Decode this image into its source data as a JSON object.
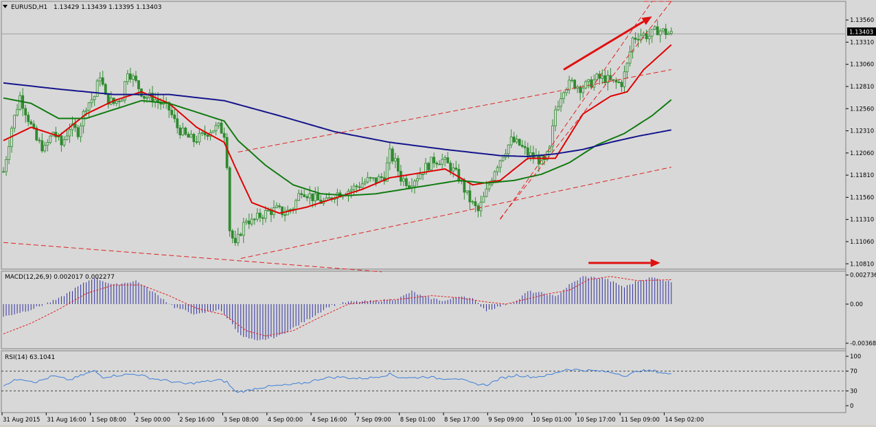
{
  "header": {
    "symbol": "EURUSD,H1",
    "ohlc": "1.13429 1.13439 1.13395 1.13403",
    "menu_icon": "triangle-down-icon"
  },
  "current_price_label": "1.13403",
  "macd_label": "MACD(12,26,9) 0.002017 0.002277",
  "rsi_label": "RSI(14) 63.1041",
  "colors": {
    "background": "#d8d8d8",
    "candle": "#2e8b2e",
    "ma_fast": "#e00000",
    "ma_mid": "#107a10",
    "ma_slow": "#14148c",
    "trendline": "#e02020",
    "annotation_arrow": "#e01010",
    "macd_hist": "#3030a0",
    "macd_signal": "#e02020",
    "rsi_line": "#3c7fd8"
  },
  "chart_data": [
    {
      "type": "candlestick",
      "title": "EURUSD,H1",
      "y_tick_labels": [
        "1.13560",
        "1.13310",
        "1.13060",
        "1.12810",
        "1.12560",
        "1.12310",
        "1.12060",
        "1.11810",
        "1.11560",
        "1.11310",
        "1.11060",
        "1.10810"
      ],
      "ylim": [
        1.1075,
        1.1377
      ],
      "x_tick_labels": [
        "31 Aug 2015",
        "31 Aug 16:00",
        "1 Sep 08:00",
        "2 Sep 00:00",
        "2 Sep 16:00",
        "3 Sep 08:00",
        "4 Sep 00:00",
        "4 Sep 16:00",
        "7 Sep 09:00",
        "8 Sep 01:00",
        "8 Sep 17:00",
        "9 Sep 09:00",
        "10 Sep 01:00",
        "10 Sep 17:00",
        "11 Sep 09:00",
        "14 Sep 02:00"
      ],
      "current_price": 1.13403,
      "close_path": [
        [
          0,
          1.1185
        ],
        [
          3,
          1.1235
        ],
        [
          6,
          1.127
        ],
        [
          9,
          1.1245
        ],
        [
          12,
          1.122
        ],
        [
          15,
          1.121
        ],
        [
          18,
          1.123
        ],
        [
          21,
          1.1215
        ],
        [
          24,
          1.1235
        ],
        [
          27,
          1.123
        ],
        [
          30,
          1.126
        ],
        [
          33,
          1.127
        ],
        [
          35,
          1.1295
        ],
        [
          37,
          1.1268
        ],
        [
          40,
          1.1262
        ],
        [
          43,
          1.127
        ],
        [
          45,
          1.13
        ],
        [
          48,
          1.1285
        ],
        [
          51,
          1.127
        ],
        [
          54,
          1.1268
        ],
        [
          57,
          1.1262
        ],
        [
          60,
          1.1255
        ],
        [
          63,
          1.1235
        ],
        [
          66,
          1.1225
        ],
        [
          69,
          1.122
        ],
        [
          72,
          1.1225
        ],
        [
          75,
          1.1232
        ],
        [
          78,
          1.1235
        ],
        [
          80,
          1.1228
        ],
        [
          81,
          1.1195
        ],
        [
          82,
          1.112
        ],
        [
          84,
          1.11
        ],
        [
          86,
          1.1118
        ],
        [
          88,
          1.1132
        ],
        [
          90,
          1.1128
        ],
        [
          93,
          1.1135
        ],
        [
          96,
          1.114
        ],
        [
          99,
          1.1142
        ],
        [
          102,
          1.1138
        ],
        [
          105,
          1.1145
        ],
        [
          108,
          1.1165
        ],
        [
          111,
          1.1158
        ],
        [
          114,
          1.1152
        ],
        [
          117,
          1.115
        ],
        [
          120,
          1.116
        ],
        [
          123,
          1.1162
        ],
        [
          126,
          1.1165
        ],
        [
          129,
          1.117
        ],
        [
          132,
          1.1175
        ],
        [
          135,
          1.1175
        ],
        [
          138,
          1.118
        ],
        [
          140,
          1.1205
        ],
        [
          142,
          1.1195
        ],
        [
          144,
          1.1178
        ],
        [
          147,
          1.1172
        ],
        [
          150,
          1.118
        ],
        [
          153,
          1.119
        ],
        [
          156,
          1.1198
        ],
        [
          159,
          1.1198
        ],
        [
          162,
          1.119
        ],
        [
          165,
          1.1178
        ],
        [
          168,
          1.1158
        ],
        [
          170,
          1.1148
        ],
        [
          172,
          1.114
        ],
        [
          175,
          1.1162
        ],
        [
          178,
          1.1188
        ],
        [
          181,
          1.1205
        ],
        [
          184,
          1.122
        ],
        [
          187,
          1.1215
        ],
        [
          190,
          1.1205
        ],
        [
          193,
          1.12
        ],
        [
          196,
          1.1195
        ],
        [
          198,
          1.121
        ],
        [
          200,
          1.1255
        ],
        [
          203,
          1.128
        ],
        [
          206,
          1.1285
        ],
        [
          209,
          1.128
        ],
        [
          212,
          1.1283
        ],
        [
          215,
          1.129
        ],
        [
          218,
          1.129
        ],
        [
          221,
          1.1285
        ],
        [
          224,
          1.1285
        ],
        [
          226,
          1.1305
        ],
        [
          228,
          1.1335
        ],
        [
          231,
          1.134
        ],
        [
          234,
          1.1338
        ],
        [
          237,
          1.1345
        ],
        [
          240,
          1.1342
        ],
        [
          242,
          1.134
        ]
      ],
      "series": [
        {
          "name": "",
          "kind": "ma_fast",
          "period": "",
          "points": [
            [
              0,
              1.122
            ],
            [
              10,
              1.1235
            ],
            [
              20,
              1.1225
            ],
            [
              30,
              1.125
            ],
            [
              40,
              1.1265
            ],
            [
              50,
              1.1275
            ],
            [
              60,
              1.1262
            ],
            [
              70,
              1.1235
            ],
            [
              80,
              1.1218
            ],
            [
              84,
              1.119
            ],
            [
              90,
              1.115
            ],
            [
              100,
              1.1138
            ],
            [
              110,
              1.1145
            ],
            [
              120,
              1.1155
            ],
            [
              130,
              1.1165
            ],
            [
              140,
              1.1178
            ],
            [
              150,
              1.1183
            ],
            [
              160,
              1.1188
            ],
            [
              170,
              1.117
            ],
            [
              180,
              1.1175
            ],
            [
              190,
              1.12
            ],
            [
              200,
              1.12
            ],
            [
              210,
              1.125
            ],
            [
              220,
              1.127
            ],
            [
              226,
              1.1275
            ],
            [
              232,
              1.13
            ],
            [
              242,
              1.1328
            ]
          ]
        },
        {
          "name": "",
          "kind": "ma_mid",
          "points": [
            [
              0,
              1.1268
            ],
            [
              10,
              1.1262
            ],
            [
              20,
              1.1245
            ],
            [
              30,
              1.1245
            ],
            [
              40,
              1.1255
            ],
            [
              50,
              1.1265
            ],
            [
              60,
              1.1262
            ],
            [
              70,
              1.1252
            ],
            [
              80,
              1.1242
            ],
            [
              85,
              1.122
            ],
            [
              95,
              1.1192
            ],
            [
              105,
              1.117
            ],
            [
              115,
              1.116
            ],
            [
              125,
              1.1158
            ],
            [
              135,
              1.116
            ],
            [
              145,
              1.1165
            ],
            [
              155,
              1.117
            ],
            [
              165,
              1.1175
            ],
            [
              175,
              1.1172
            ],
            [
              185,
              1.1175
            ],
            [
              195,
              1.1182
            ],
            [
              205,
              1.1195
            ],
            [
              215,
              1.1215
            ],
            [
              225,
              1.1228
            ],
            [
              235,
              1.1248
            ],
            [
              242,
              1.1266
            ]
          ]
        },
        {
          "name": "",
          "kind": "ma_slow",
          "points": [
            [
              0,
              1.1285
            ],
            [
              20,
              1.1278
            ],
            [
              40,
              1.1272
            ],
            [
              60,
              1.1272
            ],
            [
              80,
              1.1265
            ],
            [
              100,
              1.1248
            ],
            [
              120,
              1.123
            ],
            [
              140,
              1.1218
            ],
            [
              160,
              1.121
            ],
            [
              180,
              1.1203
            ],
            [
              190,
              1.1202
            ],
            [
              200,
              1.1205
            ],
            [
              210,
              1.121
            ],
            [
              220,
              1.1218
            ],
            [
              230,
              1.1225
            ],
            [
              242,
              1.1232
            ]
          ]
        }
      ],
      "trendlines": [
        {
          "from": [
            0,
            1.1105
          ],
          "to": [
            137,
            1.1072
          ]
        },
        {
          "from": [
            86,
            1.1087
          ],
          "to": [
            242,
            1.119
          ]
        },
        {
          "from": [
            85,
            1.1207
          ],
          "to": [
            242,
            1.13
          ]
        },
        {
          "from": [
            180,
            1.1132
          ],
          "to": [
            242,
            1.1377
          ]
        },
        {
          "from": [
            180,
            1.1131
          ],
          "to": [
            235,
            1.1377
          ]
        },
        {
          "from": [
            232,
            1.1377
          ],
          "to": [
            242,
            1.1377
          ]
        }
      ],
      "annotations": [
        {
          "type": "arrow",
          "from": [
            203,
            1.13
          ],
          "to": [
            235,
            1.136
          ]
        },
        {
          "type": "arrow",
          "from": [
            212,
            1.1082
          ],
          "to": [
            238,
            1.1082
          ]
        }
      ]
    },
    {
      "type": "bar",
      "title": "MACD(12,26,9) 0.002017 0.002277",
      "y_tick_labels": [
        "0.002736",
        "0.00",
        "-0.00368"
      ],
      "ylim": [
        -0.0042,
        0.0031
      ],
      "values_path": [
        [
          0,
          -0.0012
        ],
        [
          10,
          -0.0005
        ],
        [
          20,
          0.0005
        ],
        [
          28,
          0.0018
        ],
        [
          33,
          0.0025
        ],
        [
          40,
          0.0018
        ],
        [
          48,
          0.0022
        ],
        [
          55,
          0.001
        ],
        [
          62,
          -0.0003
        ],
        [
          70,
          -0.001
        ],
        [
          78,
          -0.0005
        ],
        [
          82,
          -0.0015
        ],
        [
          86,
          -0.003
        ],
        [
          92,
          -0.0035
        ],
        [
          100,
          -0.003
        ],
        [
          110,
          -0.0015
        ],
        [
          118,
          -0.0002
        ],
        [
          125,
          0.0002
        ],
        [
          135,
          0.0003
        ],
        [
          143,
          0.0005
        ],
        [
          148,
          0.0012
        ],
        [
          152,
          0.0007
        ],
        [
          160,
          0.0003
        ],
        [
          166,
          0.0008
        ],
        [
          170,
          0.0005
        ],
        [
          175,
          -0.0006
        ],
        [
          180,
          -0.0002
        ],
        [
          186,
          0.0003
        ],
        [
          190,
          0.0012
        ],
        [
          196,
          0.001
        ],
        [
          200,
          0.0007
        ],
        [
          205,
          0.0018
        ],
        [
          210,
          0.0026
        ],
        [
          218,
          0.0024
        ],
        [
          225,
          0.0016
        ],
        [
          230,
          0.0022
        ],
        [
          235,
          0.0025
        ],
        [
          242,
          0.0021
        ]
      ],
      "signal_path": [
        [
          0,
          -0.0028
        ],
        [
          10,
          -0.0018
        ],
        [
          20,
          -0.0005
        ],
        [
          30,
          0.001
        ],
        [
          40,
          0.0018
        ],
        [
          50,
          0.0018
        ],
        [
          60,
          0.0008
        ],
        [
          70,
          -0.0004
        ],
        [
          80,
          -0.001
        ],
        [
          88,
          -0.0025
        ],
        [
          95,
          -0.003
        ],
        [
          105,
          -0.0025
        ],
        [
          115,
          -0.0012
        ],
        [
          125,
          0.0
        ],
        [
          135,
          0.0003
        ],
        [
          145,
          0.0005
        ],
        [
          155,
          0.0008
        ],
        [
          165,
          0.0006
        ],
        [
          175,
          0.0002
        ],
        [
          182,
          0.0
        ],
        [
          190,
          0.0005
        ],
        [
          198,
          0.001
        ],
        [
          205,
          0.0013
        ],
        [
          212,
          0.0023
        ],
        [
          220,
          0.0026
        ],
        [
          230,
          0.0022
        ],
        [
          242,
          0.0023
        ]
      ]
    },
    {
      "type": "line",
      "title": "RSI(14) 63.1041",
      "y_tick_labels": [
        "100",
        "70",
        "30",
        "0"
      ],
      "ylim": [
        0,
        100
      ],
      "levels": [
        70,
        30
      ],
      "values_path": [
        [
          0,
          42
        ],
        [
          6,
          55
        ],
        [
          12,
          48
        ],
        [
          18,
          60
        ],
        [
          24,
          52
        ],
        [
          30,
          65
        ],
        [
          33,
          70
        ],
        [
          36,
          58
        ],
        [
          42,
          62
        ],
        [
          48,
          64
        ],
        [
          54,
          55
        ],
        [
          60,
          50
        ],
        [
          66,
          44
        ],
        [
          72,
          48
        ],
        [
          78,
          52
        ],
        [
          81,
          48
        ],
        [
          84,
          28
        ],
        [
          88,
          30
        ],
        [
          92,
          36
        ],
        [
          98,
          40
        ],
        [
          104,
          42
        ],
        [
          110,
          47
        ],
        [
          116,
          56
        ],
        [
          122,
          58
        ],
        [
          128,
          55
        ],
        [
          134,
          57
        ],
        [
          140,
          64
        ],
        [
          143,
          58
        ],
        [
          148,
          56
        ],
        [
          153,
          59
        ],
        [
          158,
          55
        ],
        [
          164,
          56
        ],
        [
          170,
          45
        ],
        [
          175,
          42
        ],
        [
          180,
          55
        ],
        [
          186,
          62
        ],
        [
          192,
          58
        ],
        [
          198,
          62
        ],
        [
          204,
          74
        ],
        [
          210,
          72
        ],
        [
          216,
          70
        ],
        [
          222,
          66
        ],
        [
          226,
          60
        ],
        [
          230,
          71
        ],
        [
          236,
          70
        ],
        [
          242,
          63
        ]
      ]
    }
  ]
}
